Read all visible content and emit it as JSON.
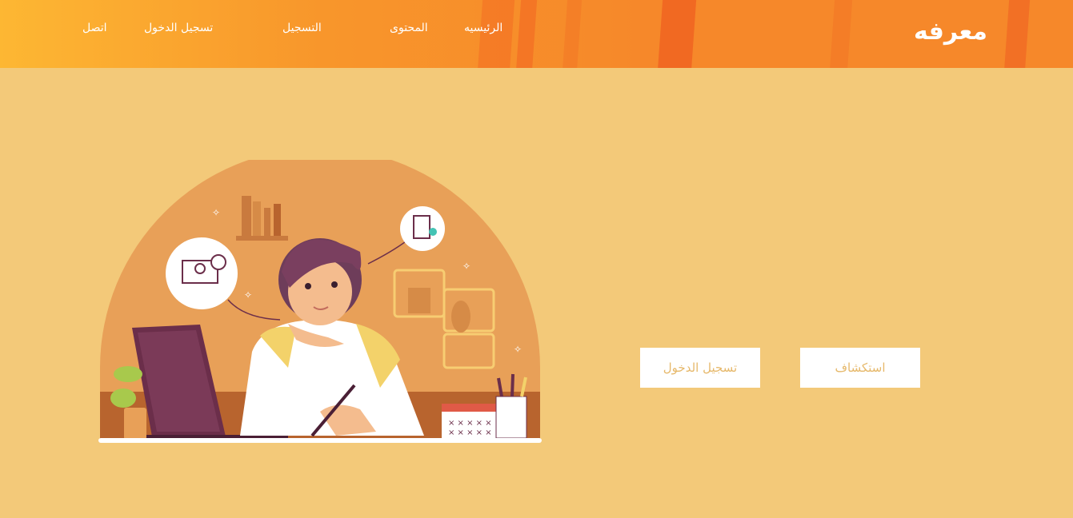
{
  "brand": {
    "name": "معرفه"
  },
  "nav": {
    "items": [
      {
        "label": "الرئيسيه"
      },
      {
        "label": "المحتوى"
      },
      {
        "label": "التسجيل"
      },
      {
        "label": "تسجيل الدخول"
      },
      {
        "label": "اتصل"
      }
    ]
  },
  "hero": {
    "explore_label": "استكشاف",
    "login_label": "تسجيل الدخول"
  },
  "colors": {
    "header_start": "#fdb733",
    "header_end": "#f6882a",
    "page_background": "#f3c979",
    "button_text": "#e6b86a"
  }
}
